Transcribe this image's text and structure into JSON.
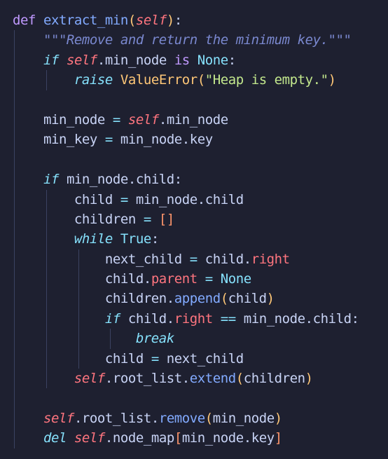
{
  "colors": {
    "background": "#1e2030",
    "text": "#c8d3f5",
    "keyword": "#c099ff",
    "control_keyword": "#86e1fc",
    "self": "#ff757f",
    "function": "#82aaff",
    "string": "#c3e88d",
    "docstring": "#7a88cf",
    "class": "#ffc777",
    "indent_guide": "#3b4261"
  },
  "code": {
    "lines": [
      {
        "indent": 0,
        "tokens": [
          [
            "kw",
            "def"
          ],
          [
            "plain",
            " "
          ],
          [
            "fn",
            "extract_min"
          ],
          [
            "paren",
            "("
          ],
          [
            "self",
            "self"
          ],
          [
            "paren",
            ")"
          ],
          [
            "plain",
            ":"
          ]
        ]
      },
      {
        "indent": 1,
        "tokens": [
          [
            "doc",
            "\"\"\"Remove and return the minimum key.\"\"\""
          ]
        ]
      },
      {
        "indent": 1,
        "tokens": [
          [
            "kw-i",
            "if"
          ],
          [
            "plain",
            " "
          ],
          [
            "self",
            "self"
          ],
          [
            "plain",
            ".min_node "
          ],
          [
            "kw",
            "is"
          ],
          [
            "plain",
            " "
          ],
          [
            "const",
            "None"
          ],
          [
            "plain",
            ":"
          ]
        ]
      },
      {
        "indent": 2,
        "tokens": [
          [
            "kw-i",
            "raise"
          ],
          [
            "plain",
            " "
          ],
          [
            "cls",
            "ValueError"
          ],
          [
            "paren",
            "("
          ],
          [
            "str",
            "\"Heap is empty.\""
          ],
          [
            "paren",
            ")"
          ]
        ]
      },
      {
        "indent": 0,
        "tokens": []
      },
      {
        "indent": 1,
        "tokens": [
          [
            "plain",
            "min_node "
          ],
          [
            "op",
            "="
          ],
          [
            "plain",
            " "
          ],
          [
            "self",
            "self"
          ],
          [
            "plain",
            ".min_node"
          ]
        ]
      },
      {
        "indent": 1,
        "tokens": [
          [
            "plain",
            "min_key "
          ],
          [
            "op",
            "="
          ],
          [
            "plain",
            " min_node.key"
          ]
        ]
      },
      {
        "indent": 0,
        "tokens": []
      },
      {
        "indent": 1,
        "tokens": [
          [
            "kw-i",
            "if"
          ],
          [
            "plain",
            " min_node.child:"
          ]
        ]
      },
      {
        "indent": 2,
        "tokens": [
          [
            "plain",
            "child "
          ],
          [
            "op",
            "="
          ],
          [
            "plain",
            " min_node.child"
          ]
        ]
      },
      {
        "indent": 2,
        "tokens": [
          [
            "plain",
            "children "
          ],
          [
            "op",
            "="
          ],
          [
            "plain",
            " "
          ],
          [
            "bracket",
            "[]"
          ]
        ]
      },
      {
        "indent": 2,
        "tokens": [
          [
            "kw-i",
            "while"
          ],
          [
            "plain",
            " "
          ],
          [
            "const",
            "True"
          ],
          [
            "plain",
            ":"
          ]
        ]
      },
      {
        "indent": 3,
        "tokens": [
          [
            "plain",
            "next_child "
          ],
          [
            "op",
            "="
          ],
          [
            "plain",
            " child."
          ],
          [
            "prop",
            "right"
          ]
        ]
      },
      {
        "indent": 3,
        "tokens": [
          [
            "plain",
            "child."
          ],
          [
            "prop",
            "parent"
          ],
          [
            "plain",
            " "
          ],
          [
            "op",
            "="
          ],
          [
            "plain",
            " "
          ],
          [
            "const",
            "None"
          ]
        ]
      },
      {
        "indent": 3,
        "tokens": [
          [
            "plain",
            "children."
          ],
          [
            "fn",
            "append"
          ],
          [
            "paren",
            "("
          ],
          [
            "plain",
            "child"
          ],
          [
            "paren",
            ")"
          ]
        ]
      },
      {
        "indent": 3,
        "tokens": [
          [
            "kw-i",
            "if"
          ],
          [
            "plain",
            " child."
          ],
          [
            "prop",
            "right"
          ],
          [
            "plain",
            " "
          ],
          [
            "op",
            "=="
          ],
          [
            "plain",
            " min_node.child:"
          ]
        ]
      },
      {
        "indent": 4,
        "tokens": [
          [
            "kw-i",
            "break"
          ]
        ]
      },
      {
        "indent": 3,
        "tokens": [
          [
            "plain",
            "child "
          ],
          [
            "op",
            "="
          ],
          [
            "plain",
            " next_child"
          ]
        ]
      },
      {
        "indent": 2,
        "tokens": [
          [
            "self",
            "self"
          ],
          [
            "plain",
            ".root_list."
          ],
          [
            "fn",
            "extend"
          ],
          [
            "paren",
            "("
          ],
          [
            "plain",
            "children"
          ],
          [
            "paren",
            ")"
          ]
        ]
      },
      {
        "indent": 0,
        "tokens": []
      },
      {
        "indent": 1,
        "tokens": [
          [
            "self",
            "self"
          ],
          [
            "plain",
            ".root_list."
          ],
          [
            "fn",
            "remove"
          ],
          [
            "paren",
            "("
          ],
          [
            "plain",
            "min_node"
          ],
          [
            "paren",
            ")"
          ]
        ]
      },
      {
        "indent": 1,
        "tokens": [
          [
            "kw-i",
            "del"
          ],
          [
            "plain",
            " "
          ],
          [
            "self",
            "self"
          ],
          [
            "plain",
            ".node_map"
          ],
          [
            "bracket",
            "["
          ],
          [
            "plain",
            "min_node.key"
          ],
          [
            "bracket",
            "]"
          ]
        ]
      }
    ]
  }
}
